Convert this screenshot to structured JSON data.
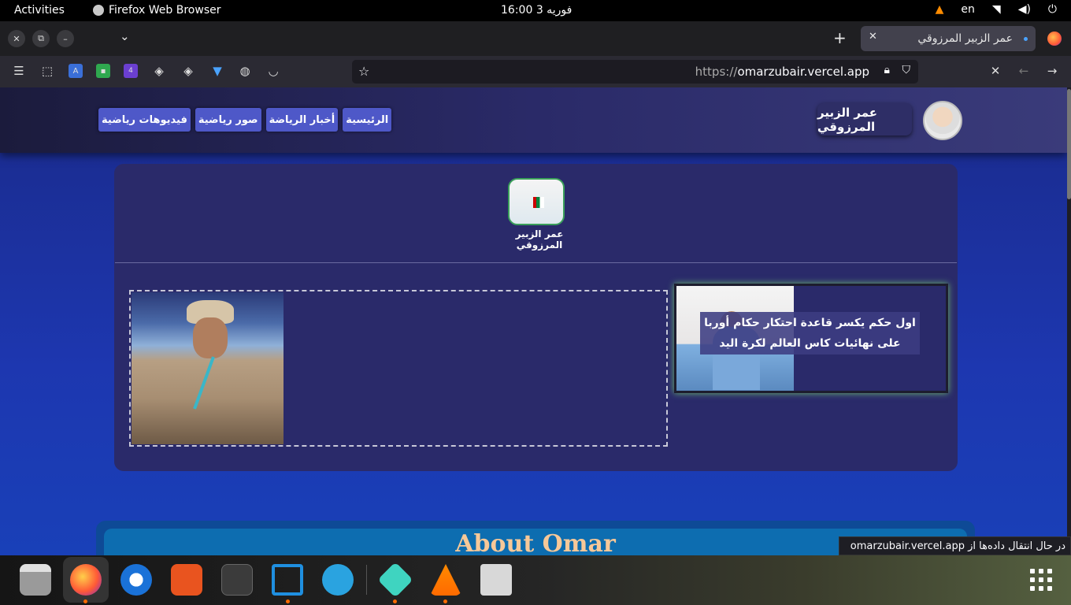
{
  "topbar": {
    "activities": "Activities",
    "app_name": "Firefox Web Browser",
    "clock": "فوریه 3  16:00",
    "lang": "en"
  },
  "tabbar": {
    "tab_title": "عمر الزبير المرزوقي",
    "new_tab": "+",
    "list_tabs": "⌄",
    "close_window": "✕",
    "restore_window": "⧉",
    "minimize_window": "–"
  },
  "navbar": {
    "url_scheme": "https://",
    "url_host": "omarzubair.vercel.app"
  },
  "site": {
    "brand": "عمر الزبير المرزوقي",
    "nav": [
      "فيديوهات رياضية",
      "صور رياضية",
      "أخبار الرياضة",
      "الرئيسية"
    ],
    "logo_title": "عمر الزبير المرزوقي",
    "news_caption": "اول حكم يكسر قاعدة احتكار حكام أوربا على نهائيات كاس العالم لكرة اليد",
    "about_title": "About Omar"
  },
  "status_text": "در حال انتقال داده‌ها از omarzubair.vercel.app",
  "dock": {
    "apps": [
      "files",
      "firefox",
      "thunderbird",
      "app-center",
      "terminal",
      "vscode",
      "telegram",
      "3d-app",
      "vlc",
      "trash"
    ]
  },
  "colors": {
    "accent_nav": "#4e58c8",
    "page_bg": "#1d37b0",
    "card_bg": "#2a2a6a",
    "about_text": "#f7c898"
  }
}
